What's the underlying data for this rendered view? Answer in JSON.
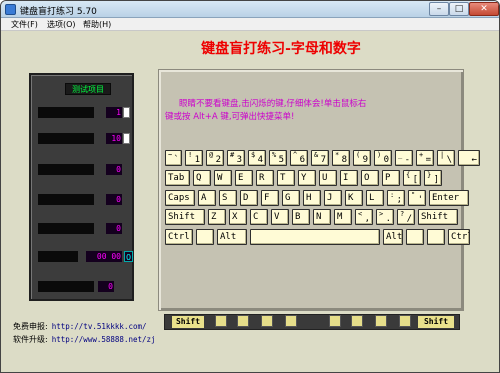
{
  "window": {
    "title": "键盘盲打练习 5.70",
    "minimize": "–",
    "maximize": "□",
    "close": "✕"
  },
  "menu": {
    "file": "文件(F)",
    "options": "选项(O)",
    "help": "帮助(H)"
  },
  "heading": "键盘盲打练习-字母和数字",
  "test_panel": {
    "title": "测试项目",
    "rows": [
      {
        "value": "1"
      },
      {
        "value": "10"
      },
      {
        "value": "0"
      },
      {
        "value": "0"
      },
      {
        "value": "0"
      },
      {
        "value": "00 00",
        "extra": "0"
      },
      {
        "value": "0"
      }
    ]
  },
  "instructions": {
    "line1": "眼睛不要看键盘,击闪烁的键,仔细体会!单击鼠标右",
    "line2": "键或按 Alt+A 键,可弹出快捷菜单!"
  },
  "keyboard": {
    "row1": [
      {
        "top": "~",
        "bottom": "`"
      },
      {
        "top": "!",
        "bottom": "1"
      },
      {
        "top": "@",
        "bottom": "2"
      },
      {
        "top": "#",
        "bottom": "3"
      },
      {
        "top": "$",
        "bottom": "4"
      },
      {
        "top": "%",
        "bottom": "5"
      },
      {
        "top": "^",
        "bottom": "6"
      },
      {
        "top": "&",
        "bottom": "7"
      },
      {
        "top": "*",
        "bottom": "8"
      },
      {
        "top": "(",
        "bottom": "9"
      },
      {
        "top": ")",
        "bottom": "0"
      },
      {
        "top": "_",
        "bottom": "-"
      },
      {
        "top": "+",
        "bottom": "="
      },
      {
        "top": "|",
        "bottom": "\\"
      },
      {
        "top": "",
        "bottom": "←"
      }
    ],
    "row2": [
      "Tab",
      "Q",
      "W",
      "E",
      "R",
      "T",
      "Y",
      "U",
      "I",
      "O",
      "P",
      {
        "top": "{",
        "bottom": "["
      },
      {
        "top": "}",
        "bottom": "]"
      }
    ],
    "row3": [
      "Caps",
      "A",
      "S",
      "D",
      "F",
      "G",
      "H",
      "J",
      "K",
      "L",
      {
        "top": ":",
        "bottom": ";"
      },
      {
        "top": "\"",
        "bottom": "'"
      },
      "Enter"
    ],
    "row4": [
      "Shift",
      "Z",
      "X",
      "C",
      "V",
      "B",
      "N",
      "M",
      {
        "top": "<",
        "bottom": ","
      },
      {
        "top": ">",
        "bottom": "."
      },
      {
        "top": "?",
        "bottom": "/"
      },
      "Shift"
    ],
    "row5": [
      "Ctrl",
      "",
      "Alt",
      "",
      "Alt",
      "",
      "",
      "Ctrl"
    ]
  },
  "footer_keys": {
    "left_shift": "Shift",
    "right_shift": "Shift"
  },
  "links": {
    "free_label": "免费申报:",
    "free_url": "http://tv.51kkkk.com/",
    "upgrade_label": "软件升级:",
    "upgrade_url": "http://www.58888.net/zj"
  }
}
